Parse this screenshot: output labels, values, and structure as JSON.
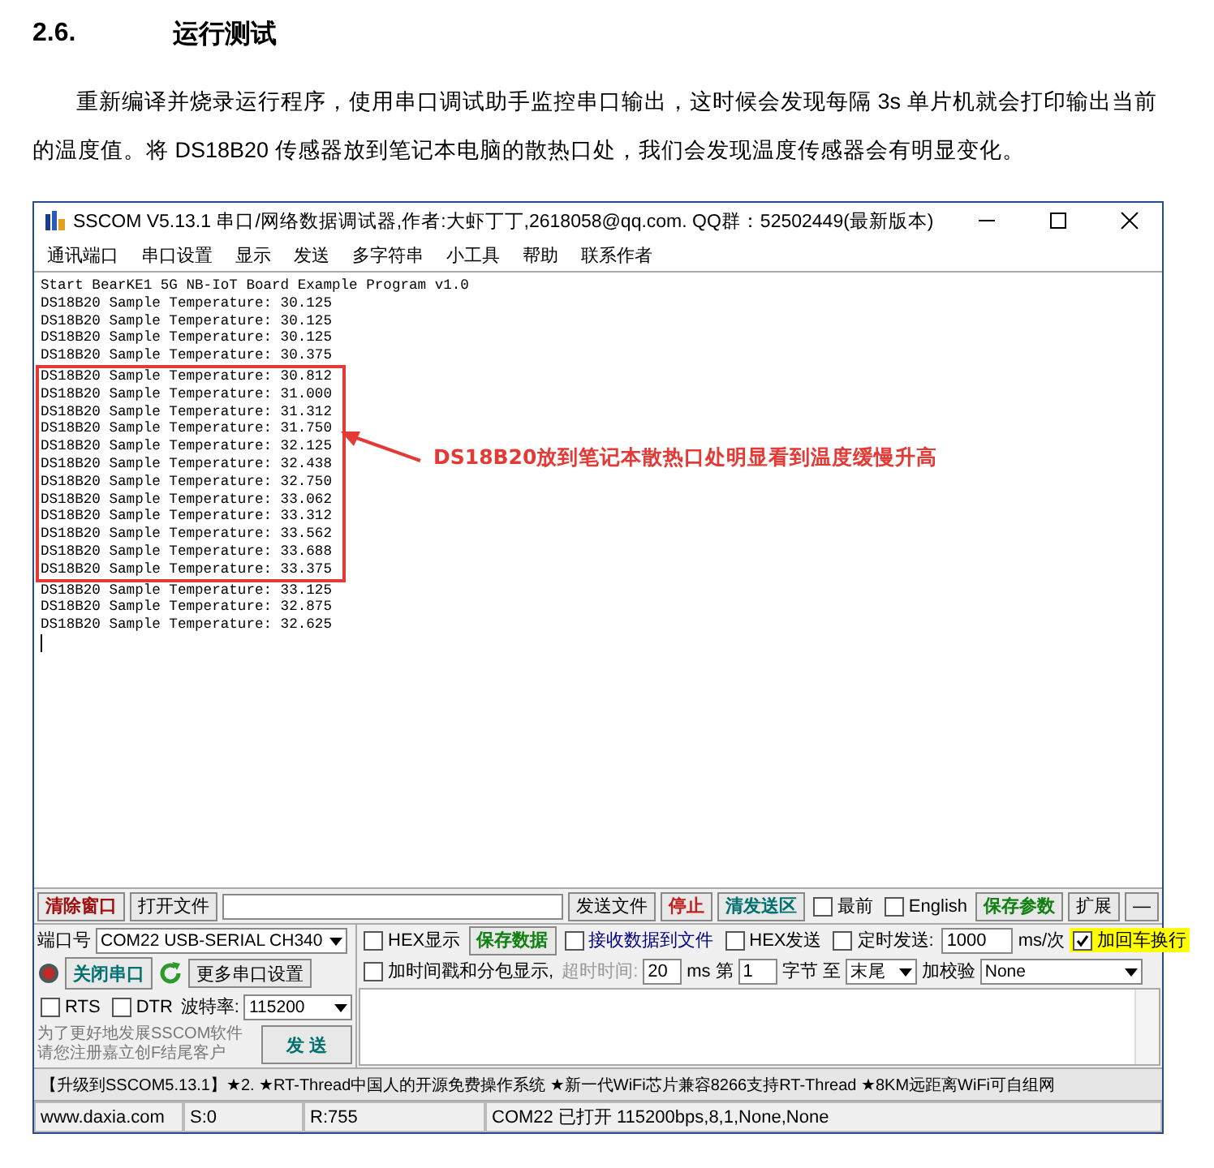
{
  "heading": {
    "number": "2.6.",
    "title": "运行测试"
  },
  "paragraph": "重新编译并烧录运行程序，使用串口调试助手监控串口输出，这时候会发现每隔 3s 单片机就会打印输出当前的温度值。将 DS18B20 传感器放到笔记本电脑的散热口处，我们会发现温度传感器会有明显变化。",
  "window": {
    "title": "SSCOM V5.13.1 串口/网络数据调试器,作者:大虾丁丁,2618058@qq.com. QQ群：52502449(最新版本)",
    "menu": [
      "通讯端口",
      "串口设置",
      "显示",
      "发送",
      "多字符串",
      "小工具",
      "帮助",
      "联系作者"
    ],
    "terminal": {
      "blocks": [
        {
          "kind": "plain",
          "lines": [
            "Start BearKE1 5G NB-IoT Board Example Program v1.0",
            "DS18B20 Sample Temperature: 30.125",
            "DS18B20 Sample Temperature: 30.125",
            "DS18B20 Sample Temperature: 30.125",
            "DS18B20 Sample Temperature: 30.375"
          ]
        },
        {
          "kind": "highlighted",
          "lines": [
            "DS18B20 Sample Temperature: 30.812",
            "DS18B20 Sample Temperature: 31.000",
            "DS18B20 Sample Temperature: 31.312",
            "DS18B20 Sample Temperature: 31.750",
            "DS18B20 Sample Temperature: 32.125",
            "DS18B20 Sample Temperature: 32.438",
            "DS18B20 Sample Temperature: 32.750",
            "DS18B20 Sample Temperature: 33.062",
            "DS18B20 Sample Temperature: 33.312",
            "DS18B20 Sample Temperature: 33.562",
            "DS18B20 Sample Temperature: 33.688",
            "DS18B20 Sample Temperature: 33.375"
          ]
        },
        {
          "kind": "plain",
          "lines": [
            "DS18B20 Sample Temperature: 33.125",
            "DS18B20 Sample Temperature: 32.875",
            "DS18B20 Sample Temperature: 32.625"
          ]
        }
      ],
      "annotation": "DS18B20放到笔记本散热口处明显看到温度缓慢升高"
    },
    "toolbar": [
      {
        "kind": "button",
        "label": "清除窗口",
        "color": "#a01010"
      },
      {
        "kind": "button",
        "label": "打开文件",
        "color": "#000000"
      },
      {
        "kind": "field"
      },
      {
        "kind": "button",
        "label": "发送文件",
        "color": "#000000"
      },
      {
        "kind": "button",
        "label": "停止",
        "color": "#c02020"
      },
      {
        "kind": "button",
        "label": "清发送区",
        "color": "#007070"
      },
      {
        "kind": "checkbox",
        "label": "最前",
        "checked": false
      },
      {
        "kind": "checkbox",
        "label": "English",
        "checked": false
      },
      {
        "kind": "button",
        "label": "保存参数",
        "color": "#108010"
      },
      {
        "kind": "button",
        "label": "扩展",
        "color": "#000000"
      },
      {
        "kind": "button",
        "label": "—",
        "color": "#000000"
      }
    ],
    "port": {
      "label": "端口号",
      "value": "COM22 USB-SERIAL CH340",
      "open_button": "关闭串口",
      "more_button": "更多串口设置",
      "rts": {
        "label": "RTS",
        "checked": false
      },
      "dtr": {
        "label": "DTR",
        "checked": false
      },
      "baud_label": "波特率:",
      "baud": "115200",
      "promo": [
        "为了更好地发展SSCOM软件",
        "请您注册嘉立创F结尾客户"
      ],
      "send_button": "发 送"
    },
    "options_row1": [
      {
        "kind": "checkbox",
        "label": "HEX显示",
        "checked": false
      },
      {
        "kind": "button",
        "label": "保存数据",
        "color": "#108010"
      },
      {
        "kind": "checkbox",
        "label": "接收数据到文件",
        "checked": false,
        "color": "#000080"
      },
      {
        "kind": "checkbox",
        "label": "HEX发送",
        "checked": false
      },
      {
        "kind": "checkbox",
        "label": "定时发送:",
        "checked": false
      },
      {
        "kind": "field",
        "value": "1000"
      },
      {
        "kind": "text",
        "label": "ms/次"
      },
      {
        "kind": "checkbox",
        "label": "加回车换行",
        "checked": true,
        "color": "#ffff00"
      }
    ],
    "options_row2": [
      {
        "kind": "checkbox",
        "label": "加时间戳和分包显示,",
        "checked": false
      },
      {
        "kind": "text",
        "label": "超时时间:",
        "disabled": true
      },
      {
        "kind": "field",
        "value": "20"
      },
      {
        "kind": "text",
        "label": "ms"
      },
      {
        "kind": "text",
        "label": "第"
      },
      {
        "kind": "field",
        "value": "1"
      },
      {
        "kind": "text",
        "label": "字节 至"
      },
      {
        "kind": "select",
        "value": "末尾"
      },
      {
        "kind": "text",
        "label": "加校验"
      },
      {
        "kind": "select",
        "value": "None"
      }
    ],
    "ticker": "【升级到SSCOM5.13.1】★2. ★RT-Thread中国人的开源免费操作系统 ★新一代WiFi芯片兼容8266支持RT-Thread ★8KM远距离WiFi可自组网",
    "status_bar": [
      "www.daxia.com",
      "S:0",
      "R:755",
      "COM22 已打开  115200bps,8,1,None,None"
    ]
  }
}
